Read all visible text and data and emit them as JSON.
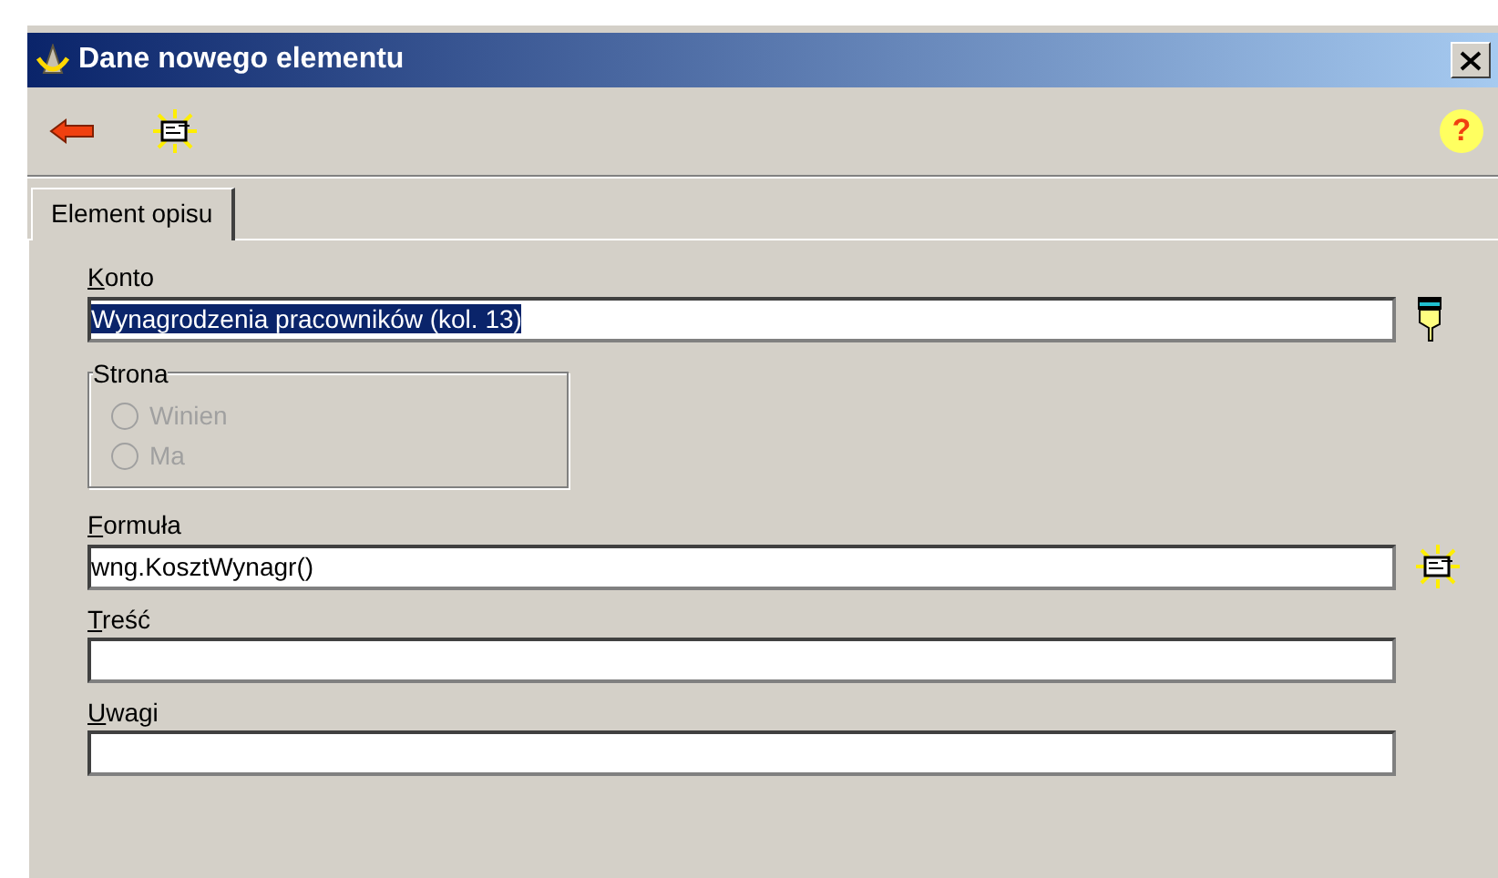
{
  "window": {
    "title": "Dane nowego elementu"
  },
  "toolbar": {
    "help_label": "?"
  },
  "tabs": [
    {
      "label": "Element opisu",
      "selected": true
    }
  ],
  "fields": [
    {
      "kind": "text",
      "label": "Konto",
      "value": "Wynagrodzenia pracowników (kol. 13)",
      "text_selected": true,
      "button": {
        "kind": "pointer"
      }
    },
    {
      "kind": "group",
      "label": "Strona",
      "disabled": true,
      "options": [
        {
          "label": "Winien",
          "selected": false
        },
        {
          "label": "Ma",
          "selected": false
        }
      ]
    },
    {
      "kind": "text",
      "label": "Formuła",
      "value": "wng.KosztWynagr()",
      "text_selected": false,
      "button": {
        "kind": "form"
      }
    },
    {
      "kind": "text",
      "label": "Treść"
    },
    {
      "kind": "text",
      "label": "Uwagi"
    }
  ]
}
